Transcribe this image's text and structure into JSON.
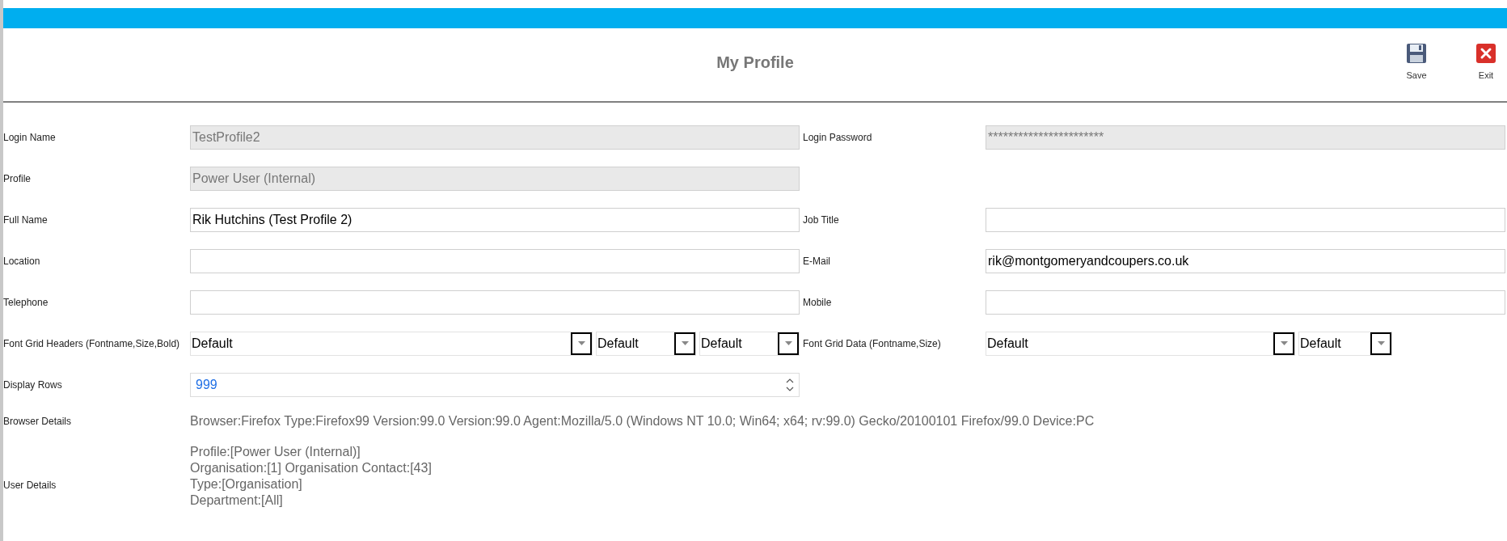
{
  "header": {
    "title": "My Profile",
    "actions": [
      {
        "kind": "save",
        "label": "Save"
      },
      {
        "kind": "exit",
        "label": "Exit"
      }
    ]
  },
  "rows": [
    {
      "left": {
        "label": "Login Name",
        "controls": [
          {
            "kind": "text",
            "value": "TestProfile2",
            "disabled": true
          }
        ]
      },
      "right": {
        "label": "Login Password",
        "controls": [
          {
            "kind": "text",
            "value": "***********************",
            "disabled": true
          }
        ]
      }
    },
    {
      "left": {
        "label": "Profile",
        "controls": [
          {
            "kind": "text",
            "value": "Power User (Internal)",
            "disabled": true
          }
        ]
      }
    },
    {
      "left": {
        "label": "Full Name",
        "controls": [
          {
            "kind": "text",
            "value": "Rik Hutchins (Test Profile 2)",
            "disabled": false
          }
        ]
      },
      "right": {
        "label": "Job Title",
        "controls": [
          {
            "kind": "text",
            "disabled": false
          }
        ]
      }
    },
    {
      "left": {
        "label": "Location",
        "controls": [
          {
            "kind": "text",
            "disabled": false
          }
        ]
      },
      "right": {
        "label": "E-Mail",
        "controls": [
          {
            "kind": "text",
            "value": "rik@montgomeryandcoupers.co.uk",
            "disabled": false
          }
        ]
      }
    },
    {
      "left": {
        "label": "Telephone",
        "controls": [
          {
            "kind": "text",
            "disabled": false
          }
        ]
      },
      "right": {
        "label": "Mobile",
        "controls": [
          {
            "kind": "text",
            "disabled": false
          }
        ]
      }
    },
    {
      "left": {
        "label": "Font Grid Headers (Fontname,Size,Bold)",
        "controls": [
          {
            "kind": "select",
            "value": "Default"
          },
          {
            "kind": "select",
            "value": "Default"
          },
          {
            "kind": "select",
            "value": "Default"
          }
        ]
      },
      "right": {
        "label": "Font Grid Data (Fontname,Size)",
        "controls": [
          {
            "kind": "select",
            "value": "Default"
          },
          {
            "kind": "select",
            "value": "Default"
          }
        ]
      }
    },
    {
      "left": {
        "label": "Display Rows",
        "controls": [
          {
            "kind": "number",
            "value": "999"
          }
        ]
      }
    }
  ],
  "browser_details": {
    "label": "Browser Details",
    "text": "Browser:Firefox Type:Firefox99 Version:99.0 Version:99.0 Agent:Mozilla/5.0 (Windows NT 10.0; Win64; x64; rv:99.0) Gecko/20100101 Firefox/99.0 Device:PC"
  },
  "user_details": {
    "label": "User Details",
    "lines": [
      "Profile:[Power User (Internal)]",
      "Organisation:[1] Organisation Contact:[43]",
      "Type:[Organisation]",
      "Department:[All]"
    ]
  }
}
